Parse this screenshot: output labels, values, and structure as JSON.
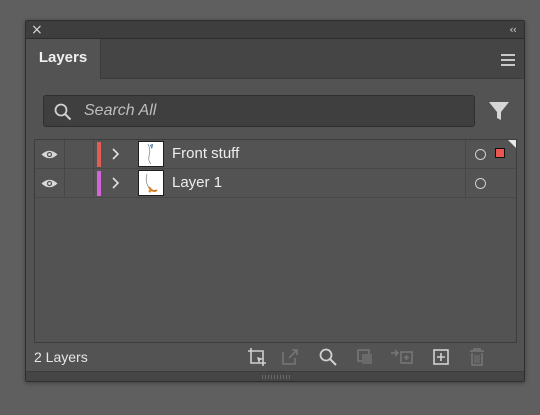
{
  "titlebar": {
    "close_glyph": "×",
    "collapse_glyph": "‹‹"
  },
  "tab": {
    "label": "Layers"
  },
  "search": {
    "placeholder": "Search All",
    "value": ""
  },
  "layers": [
    {
      "name": "Front stuff",
      "color": "#e25d55",
      "visible": true,
      "selected": true,
      "expand_icon": "chevron-right"
    },
    {
      "name": "Layer 1",
      "color": "#d664d9",
      "visible": true,
      "selected": false,
      "expand_icon": "chevron-right"
    }
  ],
  "footer": {
    "count_label": "2 Layers"
  },
  "icons": {
    "search": "search-icon",
    "filter": "filter-icon",
    "menu": "hamburger-icon",
    "eye": "eye-icon",
    "footer": [
      "artboard-icon",
      "export-icon",
      "locate-object-icon",
      "make-clipping-mask-icon",
      "move-to-layer-icon",
      "new-layer-icon",
      "delete-icon"
    ]
  },
  "colors": {
    "panel_bg": "#535353",
    "selection_square": "#ea5650"
  }
}
